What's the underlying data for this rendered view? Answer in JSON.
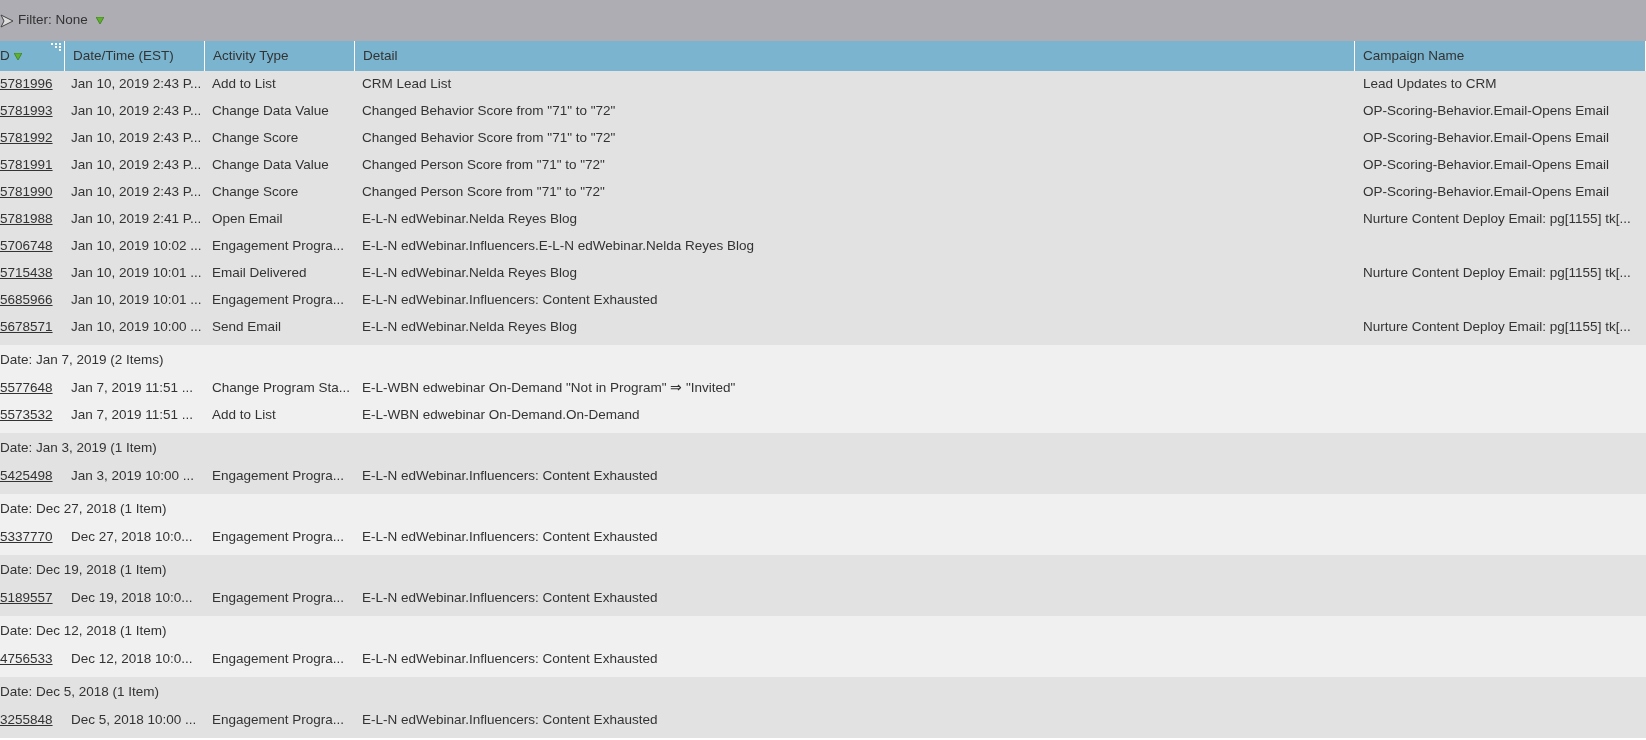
{
  "filter": {
    "label": "Filter: None"
  },
  "columns": [
    {
      "label": "D",
      "sorted": true
    },
    {
      "label": "Date/Time (EST)",
      "sorted": false
    },
    {
      "label": "Activity Type",
      "sorted": false
    },
    {
      "label": "Detail",
      "sorted": false
    },
    {
      "label": "Campaign Name",
      "sorted": false
    }
  ],
  "groups": [
    {
      "rows": [
        {
          "id": "5781996",
          "datetime": "Jan 10, 2019 2:43 P...",
          "activity": "Add to List",
          "detail": "CRM Lead List",
          "campaign": "Lead Updates to CRM"
        },
        {
          "id": "5781993",
          "datetime": "Jan 10, 2019 2:43 P...",
          "activity": "Change Data Value",
          "detail": "Changed Behavior Score from \"71\" to \"72\"",
          "campaign": "OP-Scoring-Behavior.Email-Opens Email"
        },
        {
          "id": "5781992",
          "datetime": "Jan 10, 2019 2:43 P...",
          "activity": "Change Score",
          "detail": "Changed Behavior Score from \"71\" to \"72\"",
          "campaign": "OP-Scoring-Behavior.Email-Opens Email"
        },
        {
          "id": "5781991",
          "datetime": "Jan 10, 2019 2:43 P...",
          "activity": "Change Data Value",
          "detail": "Changed Person Score from \"71\" to \"72\"",
          "campaign": "OP-Scoring-Behavior.Email-Opens Email"
        },
        {
          "id": "5781990",
          "datetime": "Jan 10, 2019 2:43 P...",
          "activity": "Change Score",
          "detail": "Changed Person Score from \"71\" to \"72\"",
          "campaign": "OP-Scoring-Behavior.Email-Opens Email"
        },
        {
          "id": "5781988",
          "datetime": "Jan 10, 2019 2:41 P...",
          "activity": "Open Email",
          "detail": "E-L-N edWebinar.Nelda Reyes Blog",
          "campaign": "Nurture Content Deploy Email: pg[1155] tk[..."
        },
        {
          "id": "5706748",
          "datetime": "Jan 10, 2019 10:02 ...",
          "activity": "Engagement Progra...",
          "detail": "E-L-N edWebinar.Influencers.E-L-N edWebinar.Nelda Reyes Blog"
        },
        {
          "id": "5715438",
          "datetime": "Jan 10, 2019 10:01 ...",
          "activity": "Email Delivered",
          "detail": "E-L-N edWebinar.Nelda Reyes Blog",
          "campaign": "Nurture Content Deploy Email: pg[1155] tk[..."
        },
        {
          "id": "5685966",
          "datetime": "Jan 10, 2019 10:01 ...",
          "activity": "Engagement Progra...",
          "detail": "E-L-N edWebinar.Influencers: Content Exhausted"
        },
        {
          "id": "5678571",
          "datetime": "Jan 10, 2019 10:00 ...",
          "activity": "Send Email",
          "detail": "E-L-N edWebinar.Nelda Reyes Blog",
          "campaign": "Nurture Content Deploy Email: pg[1155] tk[..."
        }
      ]
    },
    {
      "heading": "Date: Jan 7, 2019 (2 Items)",
      "rows": [
        {
          "id": "5577648",
          "datetime": "Jan 7, 2019 11:51 ...",
          "activity": "Change Program Sta...",
          "detail": "E-L-WBN edwebinar On-Demand \"Not in Program\" ⇒ \"Invited\""
        },
        {
          "id": "5573532",
          "datetime": "Jan 7, 2019 11:51 ...",
          "activity": "Add to List",
          "detail": "E-L-WBN edwebinar On-Demand.On-Demand"
        }
      ]
    },
    {
      "heading": "Date: Jan 3, 2019 (1 Item)",
      "rows": [
        {
          "id": "5425498",
          "datetime": "Jan 3, 2019 10:00 ...",
          "activity": "Engagement Progra...",
          "detail": "E-L-N edWebinar.Influencers: Content Exhausted"
        }
      ]
    },
    {
      "heading": "Date: Dec 27, 2018 (1 Item)",
      "rows": [
        {
          "id": "5337770",
          "datetime": "Dec 27, 2018 10:0...",
          "activity": "Engagement Progra...",
          "detail": "E-L-N edWebinar.Influencers: Content Exhausted"
        }
      ]
    },
    {
      "heading": "Date: Dec 19, 2018 (1 Item)",
      "rows": [
        {
          "id": "5189557",
          "datetime": "Dec 19, 2018 10:0...",
          "activity": "Engagement Progra...",
          "detail": "E-L-N edWebinar.Influencers: Content Exhausted"
        }
      ]
    },
    {
      "heading": "Date: Dec 12, 2018 (1 Item)",
      "rows": [
        {
          "id": "4756533",
          "datetime": "Dec 12, 2018 10:0...",
          "activity": "Engagement Progra...",
          "detail": "E-L-N edWebinar.Influencers: Content Exhausted"
        }
      ]
    },
    {
      "heading": "Date: Dec 5, 2018 (1 Item)",
      "rows": [
        {
          "id": "3255848",
          "datetime": "Dec 5, 2018 10:00 ...",
          "activity": "Engagement Progra...",
          "detail": "E-L-N edWebinar.Influencers: Content Exhausted"
        }
      ]
    }
  ]
}
